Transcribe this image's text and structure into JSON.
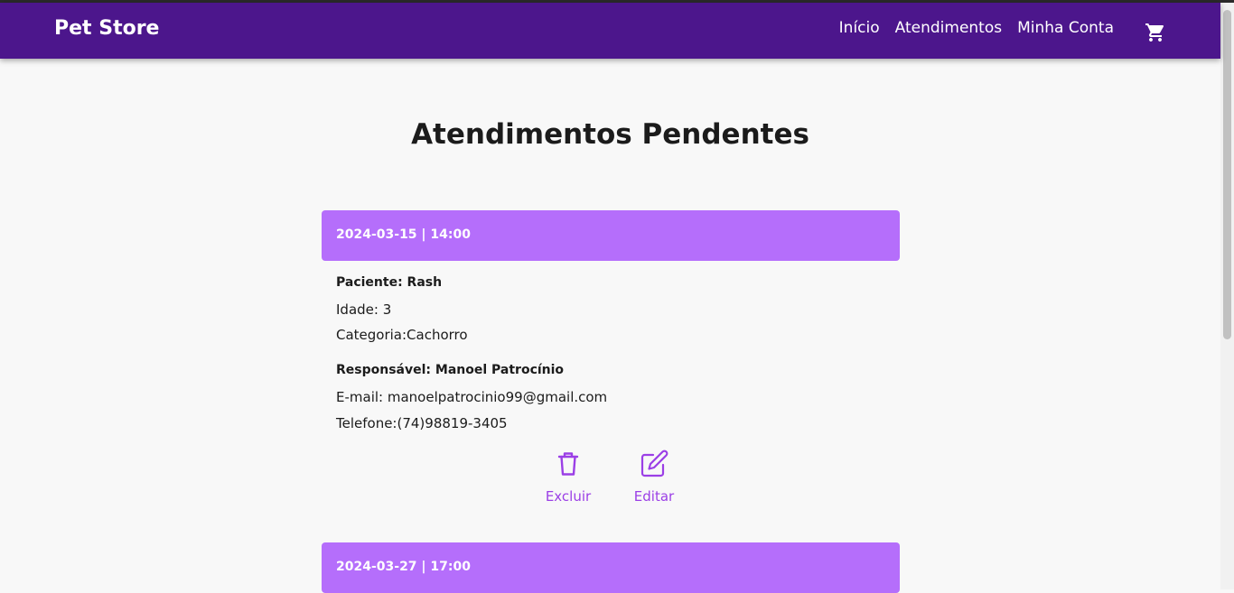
{
  "navbar": {
    "brand": "Pet Store",
    "links": [
      "Início",
      "Atendimentos",
      "Minha Conta"
    ],
    "cart_icon": "cart-icon"
  },
  "page": {
    "title": "Atendimentos Pendentes"
  },
  "appointments": [
    {
      "datetime": "2024-03-15 | 14:00",
      "patient": "Paciente: Rash",
      "age": "Idade: 3",
      "category": "Categoria:Cachorro",
      "owner": "Responsável: Manoel Patrocínio",
      "email": "E-mail: manoelpatrocinio99@gmail.com",
      "phone": "Telefone:(74)98819-3405",
      "actions": {
        "delete": "Excluir",
        "edit": "Editar"
      }
    },
    {
      "datetime": "2024-03-27 | 17:00"
    }
  ],
  "colors": {
    "navbar": "#4c168c",
    "card_header": "#b56efb",
    "accent": "#9b3fe6",
    "background": "#f8f8f8"
  }
}
